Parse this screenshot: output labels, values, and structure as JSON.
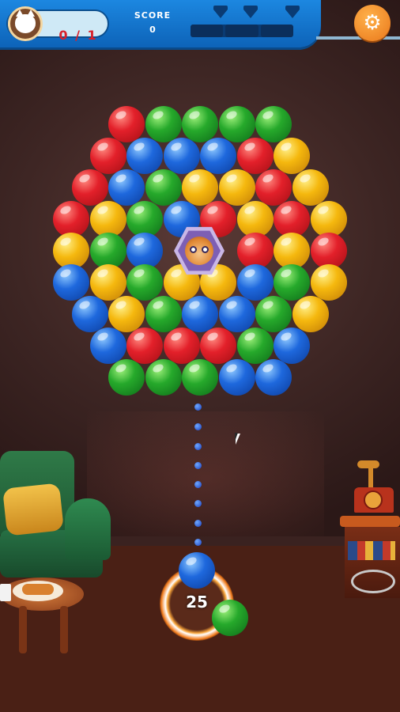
{
  "hud": {
    "goal_count": "0 / 1",
    "score_label": "SCORE",
    "score_value": "0",
    "progress_fraction": 0,
    "star_milestones": 3
  },
  "shooter": {
    "moves_left": "25",
    "current_bubble": "blue",
    "next_bubble": "green"
  },
  "icons": {
    "settings": "gear-icon",
    "avatar": "cat-avatar-icon",
    "star": "milestone-marker-icon",
    "trapped_pet": "tiger-pet-icon"
  },
  "colors": {
    "red": "#e3202a",
    "green": "#26a92b",
    "blue": "#1e68dd",
    "yellow": "#f5b80e",
    "hud_blue": "#1c87e0",
    "settings_orange": "#e9771a"
  },
  "bubble_grid": [
    [
      "red",
      "green",
      "green",
      "green",
      "green"
    ],
    [
      "red",
      "blue",
      "blue",
      "blue",
      "red",
      "yellow"
    ],
    [
      "red",
      "blue",
      "green",
      "yellow",
      "yellow",
      "red",
      "yellow"
    ],
    [
      "red",
      "yellow",
      "green",
      "blue",
      "red",
      "yellow",
      "red",
      "yellow"
    ],
    [
      "yellow",
      "green",
      "blue",
      "pet",
      "pet",
      "red",
      "yellow",
      "red"
    ],
    [
      "blue",
      "yellow",
      "green",
      "yellow",
      "yellow",
      "blue",
      "green",
      "yellow"
    ],
    [
      "blue",
      "yellow",
      "green",
      "blue",
      "blue",
      "green",
      "yellow"
    ],
    [
      "blue",
      "red",
      "red",
      "red",
      "green",
      "blue"
    ],
    [
      "green",
      "green",
      "green",
      "blue",
      "blue"
    ]
  ]
}
